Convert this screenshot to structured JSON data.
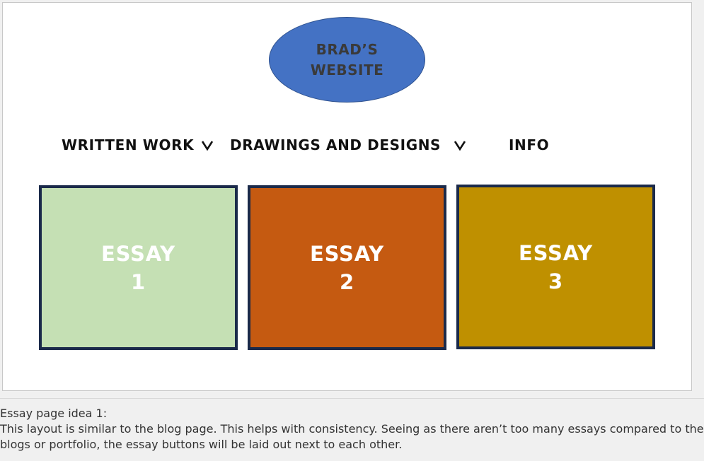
{
  "logo": {
    "text": "BRAD’S\nWEBSITE"
  },
  "nav": {
    "written_work": "WRITTEN WORK",
    "drawings_designs": "DRAWINGS AND DESIGNS",
    "info": "INFO"
  },
  "tiles": [
    {
      "label": "ESSAY\n1",
      "color": "#c5e0b4"
    },
    {
      "label": "ESSAY\n2",
      "color": "#c55a11"
    },
    {
      "label": "ESSAY\n3",
      "color": "#bf9000"
    }
  ],
  "notes": {
    "heading": "Essay page idea 1:",
    "line1": "This layout is similar to the blog page. This helps with consistency. Seeing as there aren’t too many essays compared to the",
    "line2": "blogs or portfolio, the essay buttons will be laid out next to each other."
  },
  "icons": {
    "dropdown": "chevron-down-icon"
  },
  "colors": {
    "logo_fill": "#4472c4",
    "tile_border": "#1b2a4a"
  }
}
